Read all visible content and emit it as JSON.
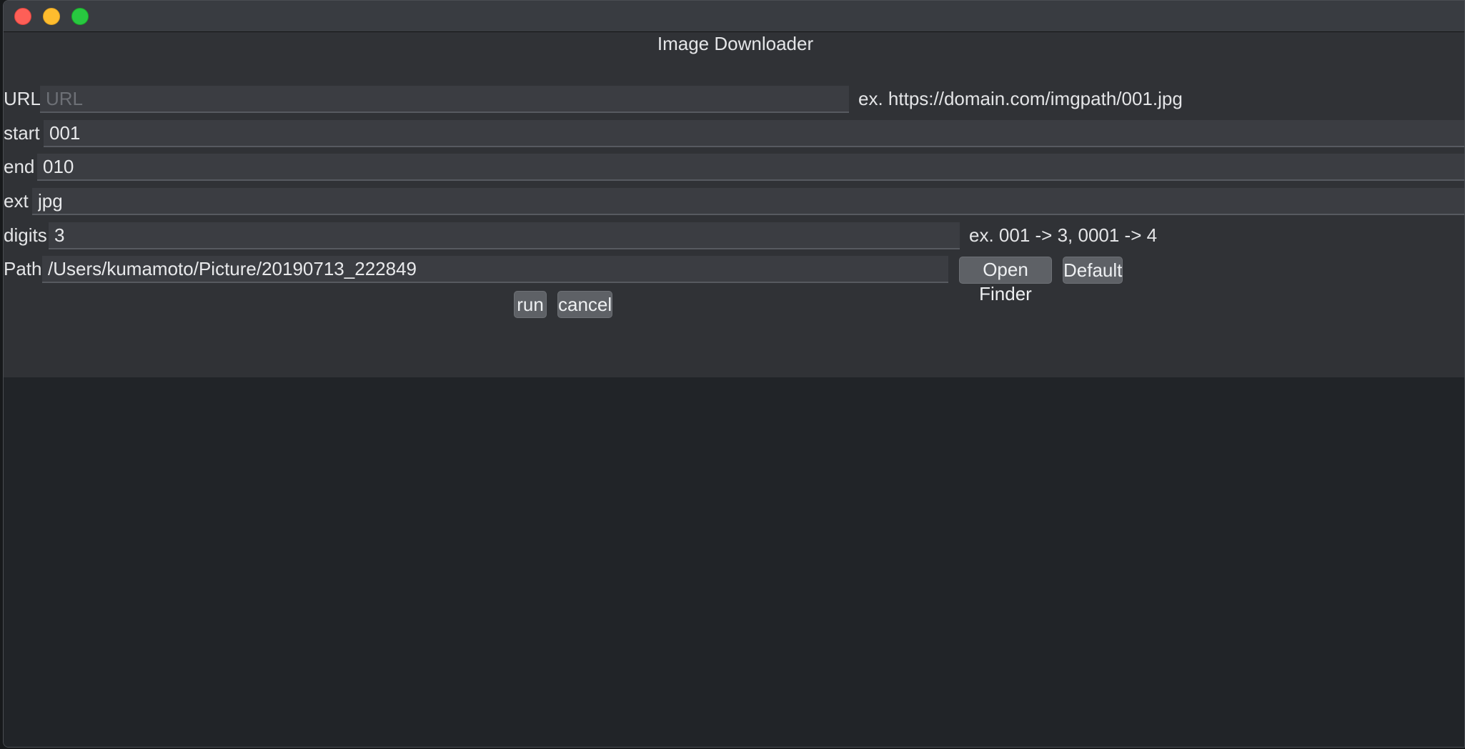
{
  "window": {
    "title": "Image Downloader"
  },
  "form": {
    "url": {
      "label": "URL",
      "value": "",
      "placeholder": "URL",
      "hint": "ex. https://domain.com/imgpath/001.jpg"
    },
    "start": {
      "label": "start",
      "value": "001"
    },
    "end": {
      "label": "end",
      "value": "010"
    },
    "ext": {
      "label": "ext",
      "value": "jpg"
    },
    "digits": {
      "label": "digits",
      "value": "3",
      "hint": "ex. 001 -> 3, 0001 -> 4"
    },
    "path": {
      "label": "Path",
      "value": "/Users/kumamoto/Picture/20190713_222849",
      "open_finder_label": "Open Finder",
      "default_label": "Default"
    }
  },
  "actions": {
    "run_label": "run",
    "cancel_label": "cancel"
  },
  "icons": {
    "close": "close-traffic-light-icon",
    "minimize": "minimize-traffic-light-icon",
    "zoom": "zoom-traffic-light-icon"
  },
  "colors": {
    "close": "#fe5f57",
    "minimize": "#febc2e",
    "zoom": "#28c840",
    "form_background": "#303236",
    "window_background": "#212428"
  }
}
